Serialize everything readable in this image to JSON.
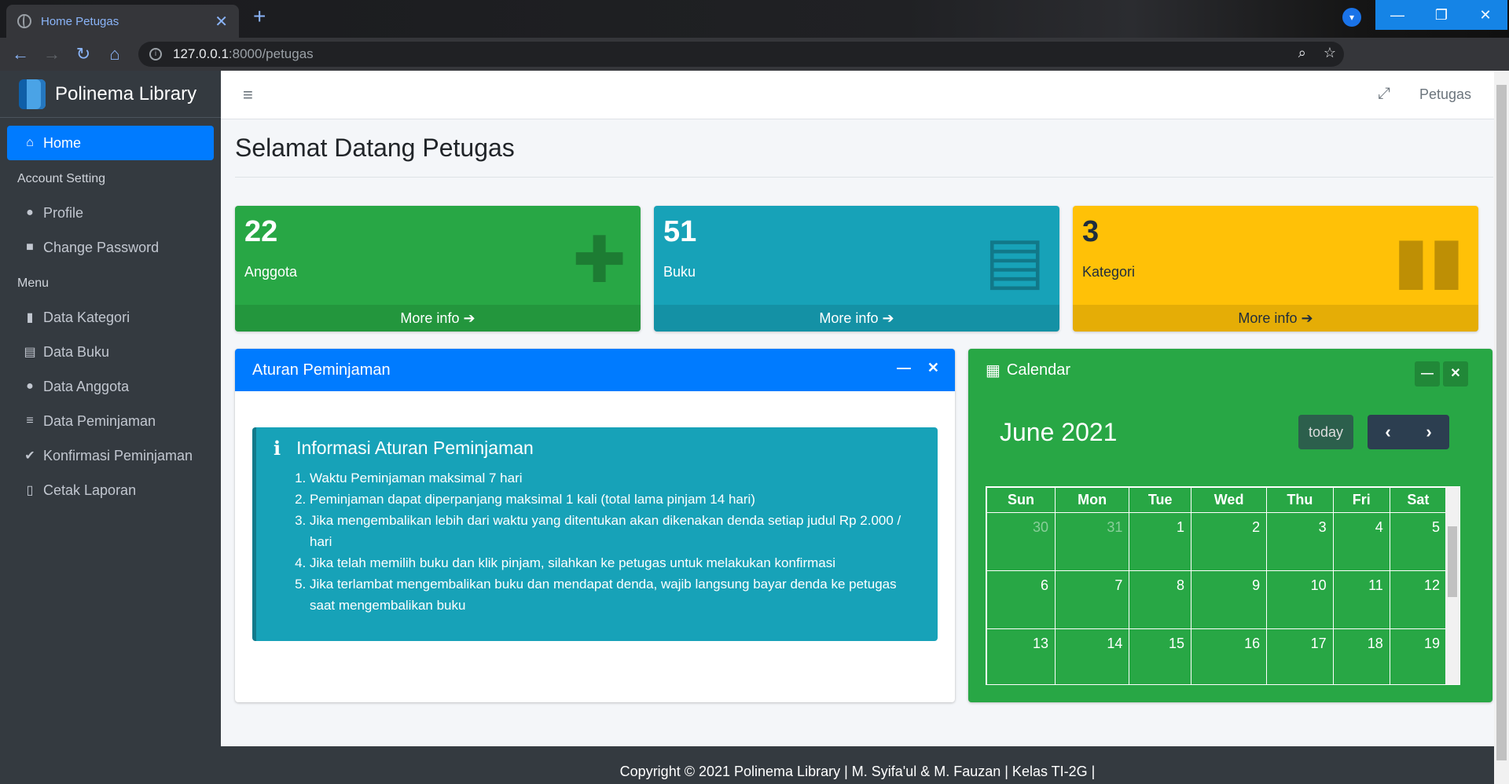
{
  "browser": {
    "tab_title": "Home Petugas",
    "url_host": "127.0.0.1",
    "url_path": ":8000/petugas"
  },
  "sidebar": {
    "brand": "Polinema Library",
    "home": "Home",
    "header_account": "Account Setting",
    "profile": "Profile",
    "change_password": "Change Password",
    "header_menu": "Menu",
    "items": [
      "Data Kategori",
      "Data Buku",
      "Data Anggota",
      "Data Peminjaman",
      "Konfirmasi Peminjaman",
      "Cetak Laporan"
    ]
  },
  "header": {
    "user": "Petugas"
  },
  "main": {
    "title": "Selamat Datang Petugas",
    "stats": [
      {
        "value": "22",
        "label": "Anggota",
        "link": "More info"
      },
      {
        "value": "51",
        "label": "Buku",
        "link": "More info"
      },
      {
        "value": "3",
        "label": "Kategori",
        "link": "More info"
      }
    ],
    "aturan": {
      "title": "Aturan Peminjaman",
      "callout_title": "Informasi Aturan Peminjaman",
      "rules": [
        "Waktu Peminjaman maksimal 7 hari",
        "Peminjaman dapat diperpanjang maksimal 1 kali (total lama pinjam 14 hari)",
        "Jika mengembalikan lebih dari waktu yang ditentukan akan dikenakan denda setiap judul Rp 2.000 / hari",
        "Jika telah memilih buku dan klik pinjam, silahkan ke petugas untuk melakukan konfirmasi",
        "Jika terlambat mengembalikan buku dan mendapat denda, wajib langsung bayar denda ke petugas saat mengembalikan buku"
      ]
    },
    "calendar": {
      "title": "Calendar",
      "month": "June 2021",
      "today": "today",
      "days": [
        "Sun",
        "Mon",
        "Tue",
        "Wed",
        "Thu",
        "Fri",
        "Sat"
      ],
      "weeks": [
        [
          "30",
          "31",
          "1",
          "2",
          "3",
          "4",
          "5"
        ],
        [
          "6",
          "7",
          "8",
          "9",
          "10",
          "11",
          "12"
        ],
        [
          "13",
          "14",
          "15",
          "16",
          "17",
          "18",
          "19"
        ]
      ]
    }
  },
  "footer": {
    "text": "Copyright © 2021 Polinema Library | M. Syifa'ul & M. Fauzan | Kelas TI-2G |"
  },
  "colors": {
    "sidebar_bg": "#343a40",
    "primary": "#007bff",
    "success": "#28a745",
    "info": "#17a2b8",
    "warning": "#ffc107"
  }
}
